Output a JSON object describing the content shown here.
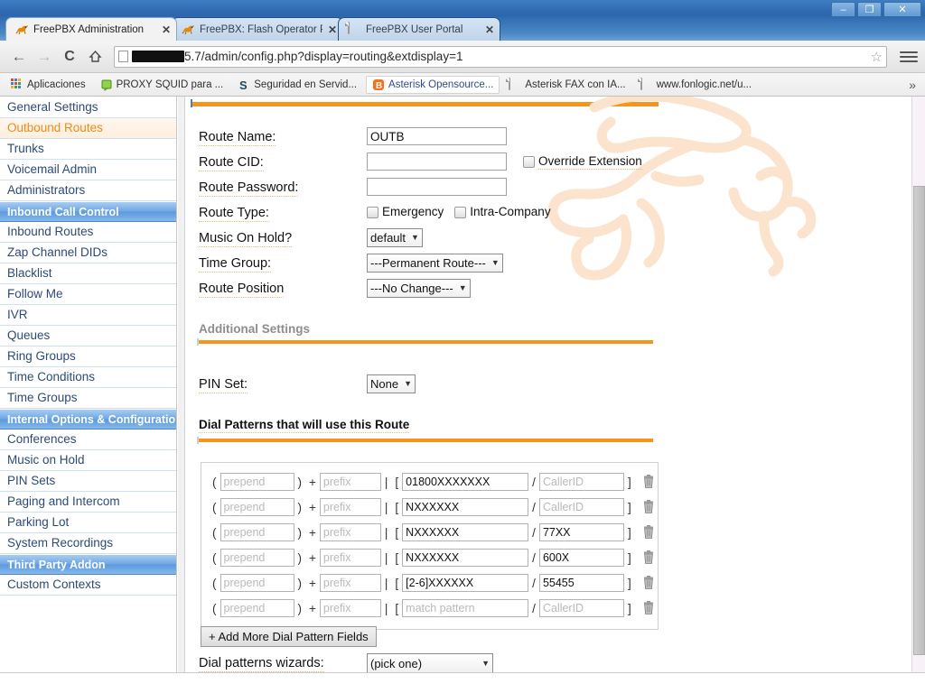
{
  "browser": {
    "window_controls": [
      {
        "name": "minimize",
        "glyph": "–"
      },
      {
        "name": "restore",
        "glyph": "❐"
      },
      {
        "name": "close",
        "glyph": "✕"
      }
    ],
    "tabs": [
      {
        "title": "FreePBX Administration",
        "favicon": "gecko-icon",
        "active": true,
        "close": "✕"
      },
      {
        "title": "FreePBX: Flash Operator P",
        "favicon": "gecko-icon",
        "active": false,
        "close": "✕"
      },
      {
        "title": "FreePBX User Portal",
        "favicon": "document-icon",
        "active": false,
        "close": "✕"
      }
    ],
    "nav": {
      "back": "←",
      "forward": "→",
      "reload": "C",
      "home": "⌂"
    },
    "omnibox": {
      "redacted_host": "",
      "url_visible": "5.7/admin/config.php?display=routing&extdisplay=1",
      "star": "☆"
    },
    "bookmarks": [
      {
        "label": "Aplicaciones",
        "icon": "apps-grid-icon",
        "highlight": false
      },
      {
        "label": "PROXY SQUID para ...",
        "icon": "green-shield-icon",
        "highlight": false
      },
      {
        "label": "Seguridad en Servid...",
        "icon": "blue-s-icon",
        "highlight": false
      },
      {
        "label": "Asterisk Opensource...",
        "icon": "blogger-icon",
        "highlight": true
      },
      {
        "label": "Asterisk FAX con IA...",
        "icon": "document-icon",
        "highlight": false
      },
      {
        "label": "www.fonlogic.net/u...",
        "icon": "document-icon",
        "highlight": false
      }
    ],
    "bookmarks_overflow": "»"
  },
  "sidebar": {
    "items": [
      {
        "label": "General Settings",
        "type": "item"
      },
      {
        "label": "Outbound Routes",
        "type": "hover"
      },
      {
        "label": "Trunks",
        "type": "item"
      },
      {
        "label": "Voicemail Admin",
        "type": "item"
      },
      {
        "label": "Administrators",
        "type": "item"
      },
      {
        "label": "Inbound Call Control",
        "type": "header"
      },
      {
        "label": "Inbound Routes",
        "type": "item"
      },
      {
        "label": "Zap Channel DIDs",
        "type": "item"
      },
      {
        "label": "Blacklist",
        "type": "item"
      },
      {
        "label": "Follow Me",
        "type": "item"
      },
      {
        "label": "IVR",
        "type": "item"
      },
      {
        "label": "Queues",
        "type": "item"
      },
      {
        "label": "Ring Groups",
        "type": "item"
      },
      {
        "label": "Time Conditions",
        "type": "item"
      },
      {
        "label": "Time Groups",
        "type": "item"
      },
      {
        "label": "Internal Options & Configuration",
        "type": "header"
      },
      {
        "label": "Conferences",
        "type": "item"
      },
      {
        "label": "Music on Hold",
        "type": "item"
      },
      {
        "label": "PIN Sets",
        "type": "item"
      },
      {
        "label": "Paging and Intercom",
        "type": "item"
      },
      {
        "label": "Parking Lot",
        "type": "item"
      },
      {
        "label": "System Recordings",
        "type": "item"
      },
      {
        "label": "Third Party Addon",
        "type": "header"
      },
      {
        "label": "Custom Contexts",
        "type": "item"
      }
    ]
  },
  "form": {
    "route_name": {
      "label": "Route Name:",
      "value": "OUTB"
    },
    "route_cid": {
      "label": "Route CID:",
      "value": "",
      "override_label": "Override Extension",
      "override_checked": false
    },
    "route_password": {
      "label": "Route Password:",
      "value": ""
    },
    "route_type": {
      "label": "Route Type:",
      "emergency_label": "Emergency",
      "emergency_checked": false,
      "intra_label": "Intra-Company",
      "intra_checked": false
    },
    "music_on_hold": {
      "label": "Music On Hold?",
      "value": "default"
    },
    "time_group": {
      "label": "Time Group:",
      "value": "---Permanent Route---"
    },
    "route_position": {
      "label": "Route Position",
      "value": "---No Change---"
    }
  },
  "additional": {
    "heading": "Additional Settings",
    "pin_set": {
      "label": "PIN Set:",
      "value": "None"
    }
  },
  "dial_patterns": {
    "heading": "Dial Patterns that will use this Route",
    "placeholders": {
      "prepend": "prepend",
      "prefix": "prefix",
      "match": "match pattern",
      "callerid": "CallerID"
    },
    "separators": {
      "open_paren": "(",
      "close_paren": ")",
      "plus": "+",
      "pipe": "|",
      "open_bracket": "[",
      "slash": "/",
      "close_bracket": "]"
    },
    "trash_icon": "trash-icon",
    "rows": [
      {
        "prepend": "",
        "prefix": "",
        "match": "01800XXXXXXX",
        "callerid": ""
      },
      {
        "prepend": "",
        "prefix": "",
        "match": "NXXXXXX",
        "callerid": ""
      },
      {
        "prepend": "",
        "prefix": "",
        "match": "NXXXXXX",
        "callerid": "77XX"
      },
      {
        "prepend": "",
        "prefix": "",
        "match": "NXXXXXX",
        "callerid": "600X"
      },
      {
        "prepend": "",
        "prefix": "",
        "match": "[2-6]XXXXXX",
        "callerid": "55455"
      },
      {
        "prepend": "",
        "prefix": "",
        "match": "",
        "callerid": ""
      }
    ],
    "add_button": "+ Add More Dial Pattern Fields",
    "wizard_label": "Dial patterns wizards:",
    "wizard_value": "(pick one)"
  },
  "colors": {
    "accent_orange": "#f7941e",
    "link_blue": "#2b4a7a",
    "hover_orange": "#f08a18",
    "header_blue": "#5b99de",
    "watermark": "#fce6cf"
  }
}
